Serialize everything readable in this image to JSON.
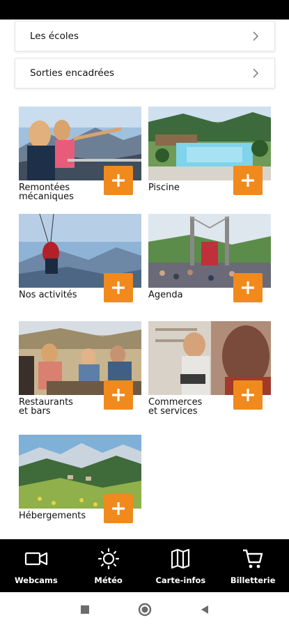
{
  "list": [
    {
      "label": "Les écoles"
    },
    {
      "label": "Sorties encadrées"
    }
  ],
  "tiles": [
    {
      "title": "Remontées\nmécaniques"
    },
    {
      "title": "Piscine"
    },
    {
      "title": "Nos activités"
    },
    {
      "title": "Agenda"
    },
    {
      "title": "Restaurants\net bars"
    },
    {
      "title": "Commerces\net services"
    },
    {
      "title": "Hébergements"
    }
  ],
  "nav": [
    {
      "label": "Webcams",
      "icon": "video-camera-icon"
    },
    {
      "label": "Météo",
      "icon": "sun-icon"
    },
    {
      "label": "Carte-infos",
      "icon": "map-icon"
    },
    {
      "label": "Billetterie",
      "icon": "cart-icon"
    }
  ],
  "colors": {
    "accent": "#f08a1c",
    "nav_bg": "#000000"
  }
}
